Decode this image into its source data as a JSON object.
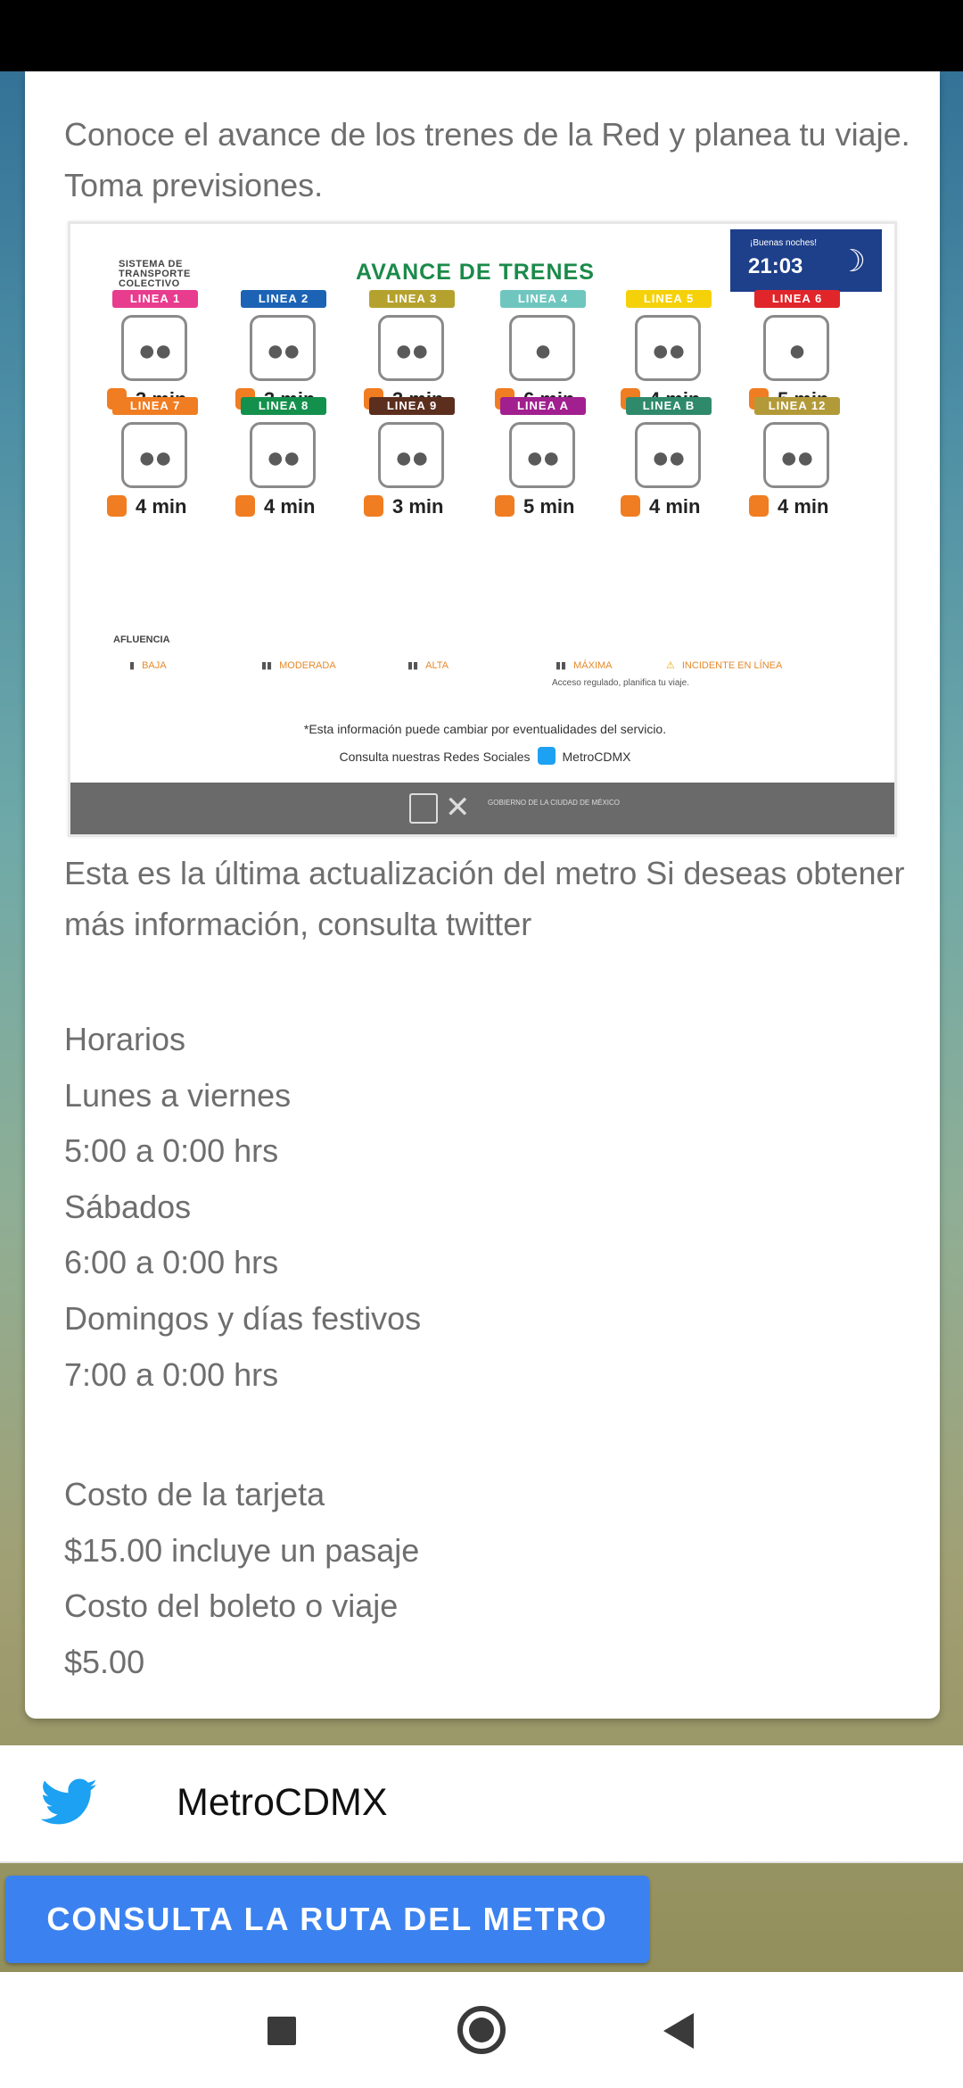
{
  "intro_text": "Conoce el avance de los trenes de la Red y planea tu viaje. Toma previsiones.",
  "metro_image": {
    "stc_label": "SISTEMA DE TRANSPORTE COLECTIVO",
    "title": "AVANCE DE TRENES",
    "greeting": "¡Buenas noches!",
    "time": "21:03",
    "lines": [
      {
        "label": "LINEA 1",
        "minutes": "3 min",
        "color": "#e83c8f"
      },
      {
        "label": "LINEA 2",
        "minutes": "3 min",
        "color": "#1d63b5"
      },
      {
        "label": "LINEA 3",
        "minutes": "3 min",
        "color": "#b5a22e"
      },
      {
        "label": "LINEA 4",
        "minutes": "6 min",
        "color": "#6fc6bf"
      },
      {
        "label": "LINEA 5",
        "minutes": "4 min",
        "color": "#f5d10a"
      },
      {
        "label": "LINEA 6",
        "minutes": "5 min",
        "color": "#e0262b"
      },
      {
        "label": "LINEA 7",
        "minutes": "4 min",
        "color": "#f07d21"
      },
      {
        "label": "LINEA 8",
        "minutes": "4 min",
        "color": "#13904c"
      },
      {
        "label": "LINEA 9",
        "minutes": "3 min",
        "color": "#5b2e1e"
      },
      {
        "label": "LINEA A",
        "minutes": "5 min",
        "color": "#a11f8f"
      },
      {
        "label": "LINEA B",
        "minutes": "4 min",
        "color": "#2f8a6c"
      },
      {
        "label": "LINEA 12",
        "minutes": "4 min",
        "color": "#b39a39"
      }
    ],
    "legend_title": "AFLUENCIA",
    "legend": [
      "BAJA",
      "MODERADA",
      "ALTA",
      "MÁXIMA",
      "INCIDENTE EN LÍNEA"
    ],
    "legend_sub": "Acceso regulado, planifica tu viaje.",
    "note": "*Esta información puede cambiar por eventualidades del servicio.",
    "social_prefix": "Consulta nuestras Redes Sociales",
    "social_handle": "MetroCDMX",
    "footer_gov": "GOBIERNO DE LA CIUDAD DE MÉXICO"
  },
  "update_text": "Esta es la última actualización del metro Si deseas obtener más información, consulta twitter",
  "schedule": {
    "heading": "Horarios",
    "weekdays_label": "Lunes a viernes",
    "weekdays_hours": "5:00 a 0:00 hrs",
    "saturday_label": "Sábados",
    "saturday_hours": "6:00 a 0:00 hrs",
    "sunday_label": "Domingos y días festivos",
    "sunday_hours": "7:00 a 0:00 hrs"
  },
  "costs": {
    "card_label": "Costo de la tarjeta",
    "card_value": "$15.00 incluye un pasaje",
    "ticket_label": "Costo del boleto o viaje",
    "ticket_value": "$5.00"
  },
  "twitter_bar": {
    "handle": "MetroCDMX",
    "icon": "twitter-bird-icon"
  },
  "cta_label": "CONSULTA LA RUTA DEL METRO",
  "colors": {
    "button": "#3b82f0",
    "twitter": "#1da1f2",
    "text": "#6e6e6e"
  }
}
